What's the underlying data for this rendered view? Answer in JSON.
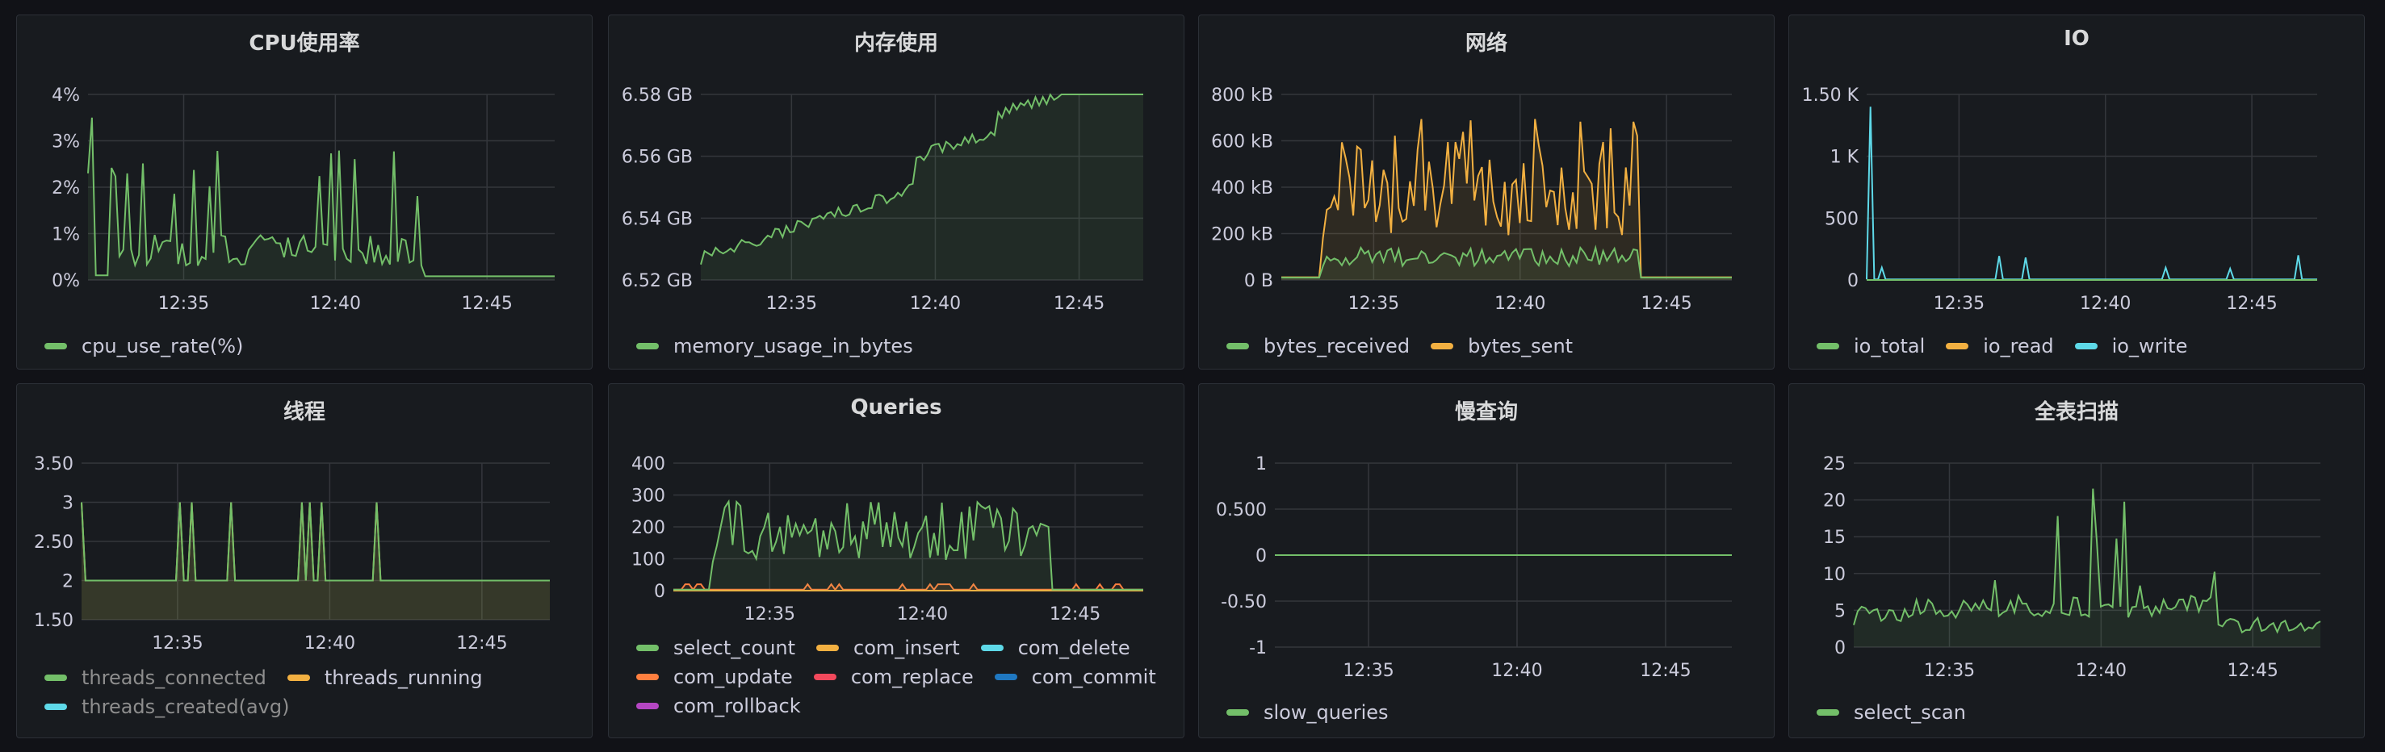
{
  "panels": [
    {
      "title": "CPU使用率",
      "chart_data": {
        "type": "line",
        "yticks": [
          "4%",
          "3%",
          "2%",
          "1%",
          "0%"
        ],
        "xticks": [
          "12:35",
          "12:40",
          "12:45"
        ],
        "ylim": [
          0,
          4
        ],
        "fill": true,
        "series": [
          {
            "name": "cpu_use_rate(%)",
            "color": "#73bf69",
            "generator": "cpu"
          }
        ]
      }
    },
    {
      "title": "内存使用",
      "chart_data": {
        "type": "line",
        "yticks": [
          "6.58 GB",
          "6.56 GB",
          "6.54 GB",
          "6.52 GB"
        ],
        "xticks": [
          "12:35",
          "12:40",
          "12:45"
        ],
        "ylim": [
          6.52,
          6.58
        ],
        "fill": true,
        "series": [
          {
            "name": "memory_usage_in_bytes",
            "color": "#73bf69",
            "generator": "mem"
          }
        ]
      }
    },
    {
      "title": "网络",
      "chart_data": {
        "type": "line",
        "yticks": [
          "800 kB",
          "600 kB",
          "400 kB",
          "200 kB",
          "0 B"
        ],
        "xticks": [
          "12:35",
          "12:40",
          "12:45"
        ],
        "ylim": [
          0,
          800
        ],
        "fill": true,
        "series": [
          {
            "name": "bytes_received",
            "color": "#73bf69",
            "generator": "netrx"
          },
          {
            "name": "bytes_sent",
            "color": "#f2b041",
            "generator": "nettx"
          }
        ]
      }
    },
    {
      "title": "IO",
      "chart_data": {
        "type": "line",
        "yticks": [
          "1.50 K",
          "1 K",
          "500",
          "0"
        ],
        "xticks": [
          "12:35",
          "12:40",
          "12:45"
        ],
        "ylim": [
          0,
          1500
        ],
        "fill": false,
        "series": [
          {
            "name": "io_total",
            "color": "#73bf69",
            "generator": "zero"
          },
          {
            "name": "io_read",
            "color": "#f2b041",
            "generator": "zero"
          },
          {
            "name": "io_write",
            "color": "#5ed9e8",
            "generator": "io"
          }
        ]
      }
    },
    {
      "title": "线程",
      "chart_data": {
        "type": "line",
        "yticks": [
          "3.50",
          "3",
          "2.50",
          "2",
          "1.50"
        ],
        "xticks": [
          "12:35",
          "12:40",
          "12:45"
        ],
        "ylim": [
          1.5,
          3.5
        ],
        "fill": true,
        "series": [
          {
            "name": "threads_connected",
            "color": "#73bf69",
            "generator": "threads",
            "dim": true
          },
          {
            "name": "threads_running",
            "color": "#f2b041",
            "generator": "threads"
          },
          {
            "name": "threads_created(avg)",
            "color": "#5ed9e8",
            "generator": "none",
            "dim": true
          }
        ]
      }
    },
    {
      "title": "Queries",
      "chart_data": {
        "type": "line",
        "yticks": [
          "400",
          "300",
          "200",
          "100",
          "0"
        ],
        "xticks": [
          "12:35",
          "12:40",
          "12:45"
        ],
        "ylim": [
          0,
          400
        ],
        "fill": true,
        "series": [
          {
            "name": "select_count",
            "color": "#73bf69",
            "generator": "select"
          },
          {
            "name": "com_insert",
            "color": "#f2b041",
            "generator": "zero"
          },
          {
            "name": "com_delete",
            "color": "#5ed9e8",
            "generator": "zero"
          },
          {
            "name": "com_update",
            "color": "#ff7f3f",
            "generator": "update"
          },
          {
            "name": "com_replace",
            "color": "#f2495c",
            "generator": "zero"
          },
          {
            "name": "com_commit",
            "color": "#1f78c1",
            "generator": "zero"
          },
          {
            "name": "com_rollback",
            "color": "#b446c2",
            "generator": "zero"
          }
        ]
      }
    },
    {
      "title": "慢查询",
      "chart_data": {
        "type": "line",
        "yticks": [
          "1",
          "0.500",
          "0",
          "-0.50",
          "-1"
        ],
        "xticks": [
          "12:35",
          "12:40",
          "12:45"
        ],
        "ylim": [
          -1,
          1
        ],
        "fill": false,
        "series": [
          {
            "name": "slow_queries",
            "color": "#73bf69",
            "generator": "zero"
          }
        ]
      }
    },
    {
      "title": "全表扫描",
      "chart_data": {
        "type": "line",
        "yticks": [
          "25",
          "20",
          "15",
          "10",
          "5",
          "0"
        ],
        "xticks": [
          "12:35",
          "12:40",
          "12:45"
        ],
        "ylim": [
          0,
          25
        ],
        "fill": true,
        "series": [
          {
            "name": "select_scan",
            "color": "#73bf69",
            "generator": "scan"
          }
        ]
      }
    }
  ]
}
